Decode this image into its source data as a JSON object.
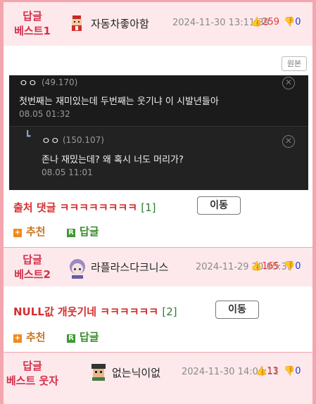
{
  "posts": [
    {
      "label": [
        "답글",
        "베스트1"
      ],
      "nickname": "자동차좋아함",
      "date": "2024-11-30 13:11:39",
      "up": "259",
      "down": "0",
      "original_label": "원본",
      "screenshot": {
        "comment1": {
          "user": "ㅇㅇ",
          "ip": "(49.170)",
          "text": "첫번째는 재미있는데 두번째는 웃기냐 이 시발년들아",
          "time": "08.05 01:32"
        },
        "comment2": {
          "arrow": "┗",
          "user": "ㅇㅇ",
          "ip": "(150.107)",
          "text": "존나 재밌는데? 왜 혹시 너도 머리가?",
          "time": "08.05 11:01"
        }
      },
      "title": "출처 댓글 ㅋㅋㅋㅋㅋㅋㅋㅋ",
      "comment_count": "[1]",
      "move_label": "이동",
      "recommend_label": "추천",
      "reply_label": "답글"
    },
    {
      "label": [
        "답글",
        "베스트2"
      ],
      "nickname": "라플라스다크니스",
      "date": "2024-11-29 20:05:39",
      "up": "165",
      "down": "0",
      "title": "NULL값 개웃기네 ㅋㅋㅋㅋㅋㅋ",
      "comment_count": "[2]",
      "move_label": "이동",
      "recommend_label": "추천",
      "reply_label": "답글"
    },
    {
      "label": [
        "답글",
        "베스트 웃자"
      ],
      "nickname": "없는닉이없",
      "date": "2024-11-30 14:04:11",
      "up": "13",
      "down": "0"
    }
  ]
}
